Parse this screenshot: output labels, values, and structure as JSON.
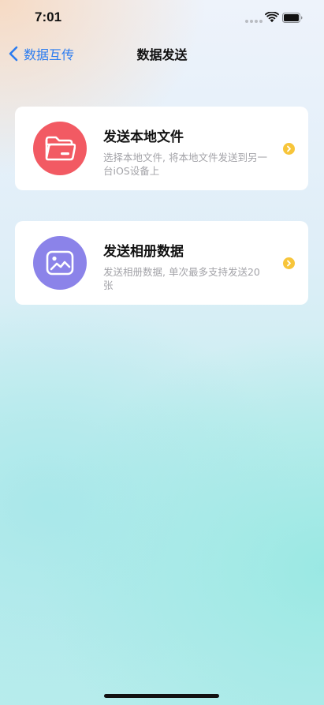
{
  "status_bar": {
    "time": "7:01"
  },
  "nav": {
    "back_label": "数据互传",
    "title": "数据发送"
  },
  "cards": [
    {
      "title": "发送本地文件",
      "description": "选择本地文件, 将本地文件发送到另一台iOS设备上",
      "icon": "folder-icon",
      "icon_color": "#f25a63"
    },
    {
      "title": "发送相册数据",
      "description": "发送相册数据, 单次最多支持发送20张",
      "icon": "photo-icon",
      "icon_color": "#8b83e9"
    }
  ],
  "colors": {
    "accent_blue": "#2b7cf0",
    "arrow_yellow": "#f7c53a"
  }
}
